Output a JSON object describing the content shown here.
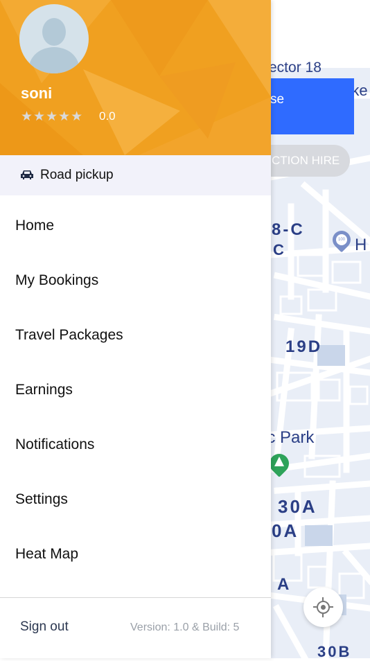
{
  "profile": {
    "name": "soni",
    "stars": "★★★★★",
    "rating": "0.0"
  },
  "road_pickup": {
    "label": "Road pickup",
    "icon": "car-icon"
  },
  "menu": {
    "items": [
      {
        "label": "Home"
      },
      {
        "label": "My Bookings"
      },
      {
        "label": "Travel Packages"
      },
      {
        "label": "Earnings"
      },
      {
        "label": "Notifications"
      },
      {
        "label": "Settings"
      },
      {
        "label": "Heat Map"
      }
    ]
  },
  "footer": {
    "sign_out": "Sign out",
    "version": "Version: 1.0 & Build: 5"
  },
  "background": {
    "map_labels": {
      "sector": "ector 18",
      "partial_right": "rke",
      "block_8c": "8-C",
      "block_c": "C",
      "poi_h": "H",
      "block_19d": "19D",
      "park": "ic Park",
      "block_30a_1": "30A",
      "block_30a_2": "0A",
      "block_a": "A",
      "block_30b": "30B"
    },
    "choose_button": "se",
    "hire_pill": "CTION HIRE",
    "poi_badge": "100",
    "locate_icon": "crosshair-icon"
  },
  "colors": {
    "header": "#f0a020",
    "choose_button": "#2f6bff",
    "map_text": "#2b3f86"
  }
}
